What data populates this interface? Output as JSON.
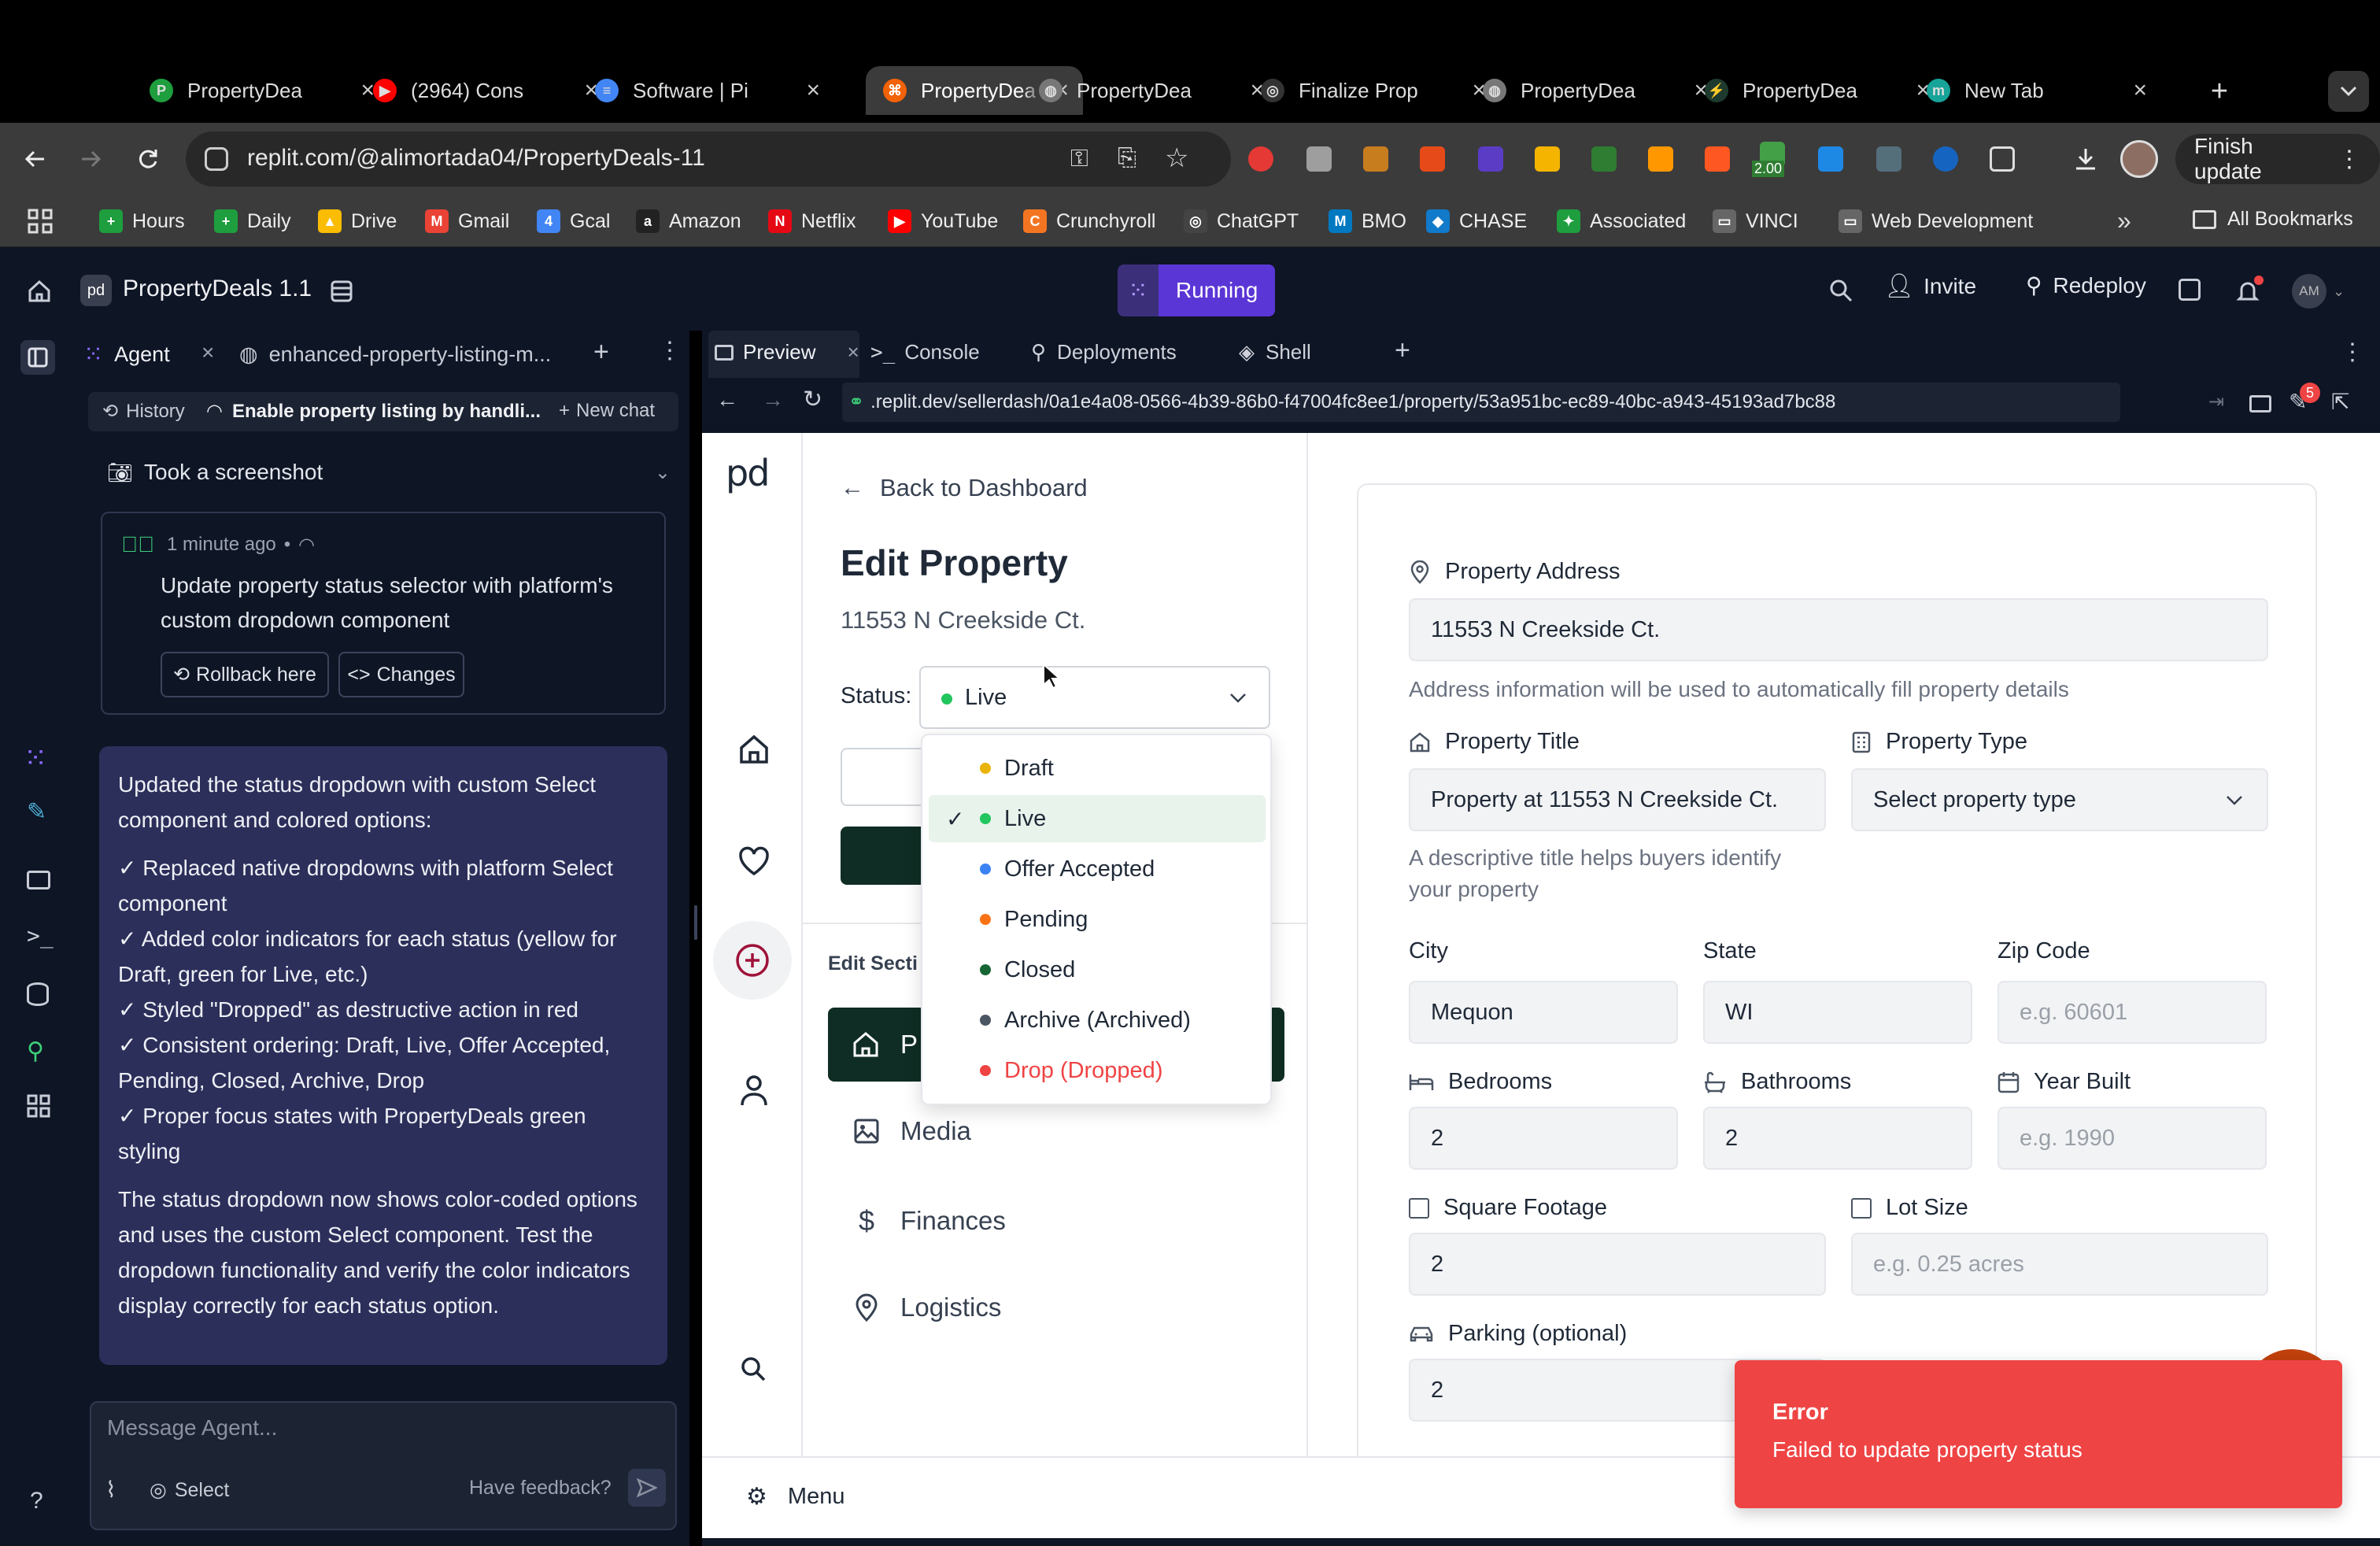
{
  "browser": {
    "tabs": [
      {
        "title": "PropertyDea",
        "favicon": "P",
        "color": "#1e9e3e"
      },
      {
        "title": "(2964) Cons",
        "favicon": "▶",
        "color": "#ff0000"
      },
      {
        "title": "Software | Pi",
        "favicon": "≡",
        "color": "#4285f4"
      },
      {
        "title": "PropertyDea",
        "favicon": "⌘",
        "color": "#f26207",
        "active": true
      },
      {
        "title": "PropertyDea",
        "favicon": "◍",
        "color": "#777"
      },
      {
        "title": "Finalize Prop",
        "favicon": "◎",
        "color": "#333"
      },
      {
        "title": "PropertyDea",
        "favicon": "◍",
        "color": "#777"
      },
      {
        "title": "PropertyDea",
        "favicon": "⚡",
        "color": "#1e3a2f"
      },
      {
        "title": "New Tab",
        "favicon": "m",
        "color": "#17a398"
      }
    ],
    "url": "replit.com/@alimortada04/PropertyDeals-11",
    "finish_update": "Finish update",
    "ext_badge": "2.00",
    "bookmarks": [
      {
        "label": "Hours",
        "icon": "+",
        "color": "#1e9e3e"
      },
      {
        "label": "Daily",
        "icon": "+",
        "color": "#1e9e3e"
      },
      {
        "label": "Drive",
        "icon": "▲",
        "color": "#fbbc04"
      },
      {
        "label": "Gmail",
        "icon": "M",
        "color": "#ea4335"
      },
      {
        "label": "Gcal",
        "icon": "4",
        "color": "#4285f4"
      },
      {
        "label": "Amazon",
        "icon": "a",
        "color": "#222"
      },
      {
        "label": "Netflix",
        "icon": "N",
        "color": "#e50914"
      },
      {
        "label": "YouTube",
        "icon": "▶",
        "color": "#ff0000"
      },
      {
        "label": "Crunchyroll",
        "icon": "C",
        "color": "#f47521"
      },
      {
        "label": "ChatGPT",
        "icon": "◎",
        "color": "#444"
      },
      {
        "label": "BMO",
        "icon": "M",
        "color": "#0079c1"
      },
      {
        "label": "CHASE",
        "icon": "◆",
        "color": "#117aca"
      },
      {
        "label": "Associated",
        "icon": "✦",
        "color": "#1e9e3e"
      },
      {
        "label": "VINCI",
        "icon": "▭",
        "color": "#666"
      },
      {
        "label": "Web Development",
        "icon": "▭",
        "color": "#666"
      }
    ],
    "all_bookmarks": "All Bookmarks"
  },
  "replit": {
    "project_name": "PropertyDeals 1.1",
    "run_status": "Running",
    "invite": "Invite",
    "redeploy": "Redeploy",
    "avatar_initials": "AM",
    "agent_tabs": {
      "agent": "Agent",
      "file": "enhanced-property-listing-m..."
    },
    "history": "History",
    "chat_title": "Enable property listing by handli...",
    "new_chat": "New chat",
    "screenshot_label": "Took a screenshot",
    "checkpoint": {
      "time": "1 minute ago",
      "text": "Update property status selector with platform's custom dropdown component",
      "rollback": "Rollback here",
      "changes": "Changes"
    },
    "agent_message": {
      "intro": "Updated the status dropdown with custom Select component and colored options:",
      "bullets": [
        "✓ Replaced native dropdowns with platform Select component",
        "✓ Added color indicators for each status (yellow for Draft, green for Live, etc.)",
        "✓ Styled \"Dropped\" as destructive action in red",
        "✓ Consistent ordering: Draft, Live, Offer Accepted, Pending, Closed, Archive, Drop",
        "✓ Proper focus states with PropertyDeals green styling"
      ],
      "outro": "The status dropdown now shows color-coded options and uses the custom Select component. Test the dropdown functionality and verify the color indicators display correctly for each status option."
    },
    "message_placeholder": "Message Agent...",
    "select": "Select",
    "feedback": "Have feedback?",
    "pane_tabs": [
      "Preview",
      "Console",
      "Deployments",
      "Shell"
    ],
    "preview_url": ".replit.dev/sellerdash/0a1e4a08-0566-4b39-86b0-f47004fc8ee1/property/53a951bc-ec89-40bc-a943-45193ad7bc88",
    "notif_count": "5",
    "help": "?"
  },
  "app": {
    "logo": "pd",
    "back": "Back to Dashboard",
    "heading": "Edit Property",
    "address": "11553 N Creekside Ct.",
    "status_label": "Status:",
    "status_value": "Live",
    "status_color": "#22c55e",
    "status_options": [
      {
        "label": "Draft",
        "color": "#eab308"
      },
      {
        "label": "Live",
        "color": "#22c55e",
        "selected": true
      },
      {
        "label": "Offer Accepted",
        "color": "#3b82f6"
      },
      {
        "label": "Pending",
        "color": "#f97316"
      },
      {
        "label": "Closed",
        "color": "#166534"
      },
      {
        "label": "Archive (Archived)",
        "color": "#4b5563"
      },
      {
        "label": "Drop (Dropped)",
        "color": "#ef4444",
        "destructive": true
      }
    ],
    "edit_sections_label": "Edit Secti",
    "sections": [
      "P",
      "Media",
      "Finances",
      "Logistics"
    ],
    "menu": "Menu",
    "form": {
      "address_label": "Property Address",
      "address_value": "11553 N Creekside Ct.",
      "address_help": "Address information will be used to automatically fill property details",
      "title_label": "Property Title",
      "title_value": "Property at 11553 N Creekside Ct.",
      "title_help_1": "A descriptive title helps buyers identify",
      "title_help_2": "your property",
      "type_label": "Property Type",
      "type_placeholder": "Select property type",
      "city_label": "City",
      "city_value": "Mequon",
      "state_label": "State",
      "state_value": "WI",
      "zip_label": "Zip Code",
      "zip_placeholder": "e.g. 60601",
      "bed_label": "Bedrooms",
      "bed_value": "2",
      "bath_label": "Bathrooms",
      "bath_value": "2",
      "year_label": "Year Built",
      "year_placeholder": "e.g. 1990",
      "sqft_label": "Square Footage",
      "sqft_value": "2",
      "lot_label": "Lot Size",
      "lot_placeholder": "e.g. 0.25 acres",
      "parking_label": "Parking (optional)",
      "parking_value": "2"
    },
    "toast": {
      "title": "Error",
      "message": "Failed to update property status",
      "color": "#ef4444"
    }
  }
}
